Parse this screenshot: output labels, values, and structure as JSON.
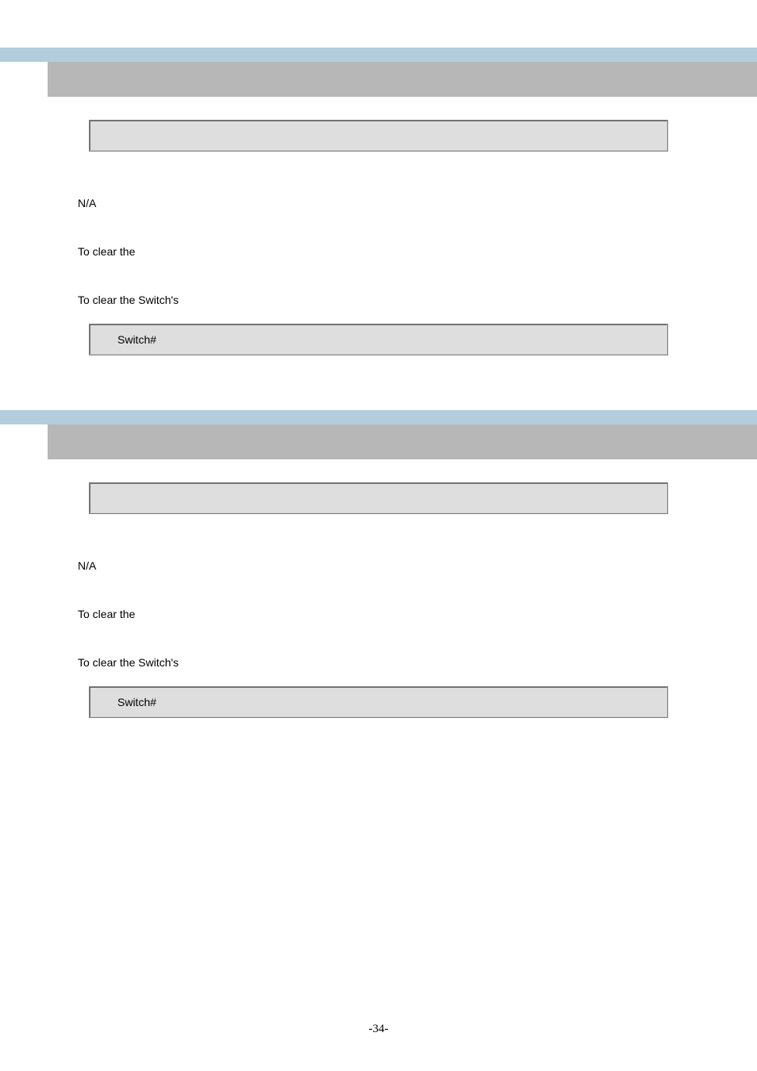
{
  "section1": {
    "parameters_text": "N/A",
    "purpose_text": "To clear the",
    "example_intro": "To clear the Switch's",
    "switch_prompt": "Switch#"
  },
  "section2": {
    "parameters_text": "N/A",
    "purpose_text": "To clear the",
    "example_intro": "To clear the Switch's",
    "switch_prompt": "Switch#"
  },
  "page_number": "-34-"
}
